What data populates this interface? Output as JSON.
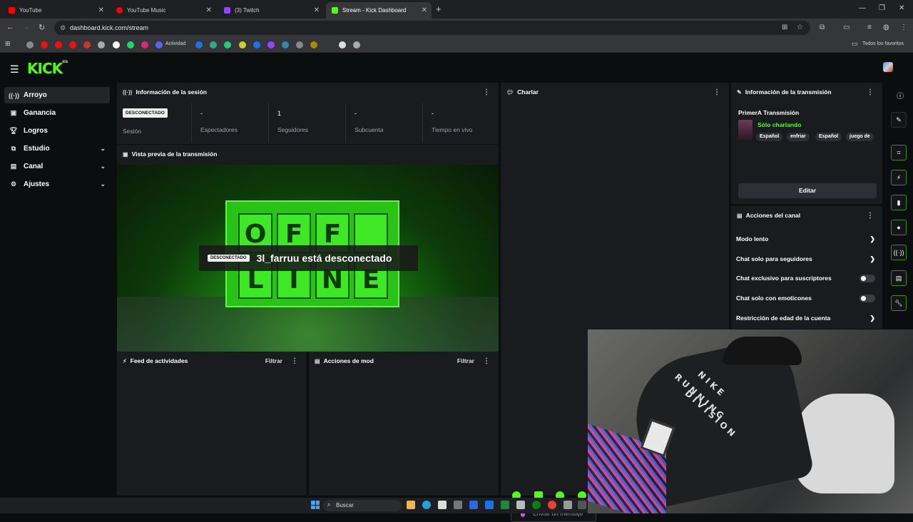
{
  "browser": {
    "tabs": [
      {
        "label": "YouTube",
        "favicon_color": "#ff0000"
      },
      {
        "label": "YouTube Music",
        "favicon_color": "#ff0000"
      },
      {
        "label": "(3) Twitch",
        "favicon_color": "#9146ff"
      },
      {
        "label": "Stream - Kick Dashboard",
        "favicon_color": "#53fc18",
        "active": true
      }
    ],
    "url": "dashboard.kick.com/stream",
    "bookmarks": {
      "actividad_label": "Actividad",
      "all_favorites_label": "Todos los favoritos"
    }
  },
  "app": {
    "logo": "KICK",
    "logo_badge": "BETA",
    "accent_color": "#53fc18"
  },
  "sidebar": {
    "items": [
      {
        "label": "Arroyo",
        "icon": "broadcast-icon",
        "active": true
      },
      {
        "label": "Ganancia",
        "icon": "money-icon"
      },
      {
        "label": "Logros",
        "icon": "trophy-icon"
      },
      {
        "label": "Estudio",
        "icon": "studio-icon",
        "expandable": true
      },
      {
        "label": "Canal",
        "icon": "channel-icon",
        "expandable": true
      },
      {
        "label": "Ajustes",
        "icon": "gear-icon",
        "expandable": true
      }
    ]
  },
  "session": {
    "title": "Información de la sesión",
    "status_badge": "DESCONECTADO",
    "status_label": "Sesión",
    "stats": [
      {
        "value": "-",
        "label": "Espectadores"
      },
      {
        "value": "1",
        "label": "Seguidores"
      },
      {
        "value": "-",
        "label": "Subcuenta"
      },
      {
        "value": "-",
        "label": "Tiempo en vivo"
      }
    ]
  },
  "preview": {
    "title": "Vista previa de la transmisión",
    "sign_letters": [
      "O",
      "F",
      "F",
      "",
      "L",
      "I",
      "N",
      "E"
    ],
    "overlay_badge": "DESCONECTADO",
    "overlay_message": "3l_farruu está desconectado"
  },
  "activity_feed": {
    "title": "Feed de actividades",
    "filter_label": "Filtrar"
  },
  "mod_actions": {
    "title": "Acciones de mod",
    "filter_label": "Filtrar"
  },
  "chat": {
    "title": "Charlar",
    "input_placeholder": "Enviar un mensaje"
  },
  "stream_info": {
    "title": "Información de la transmisión",
    "stream_title": "PrimerA Transmisión",
    "category": "Sólo charlando",
    "tags": [
      "Español",
      "enfriar",
      "Español",
      "juego de"
    ],
    "edit_label": "Editar"
  },
  "channel_actions": {
    "title": "Acciones del canal",
    "rows": [
      {
        "label": "Modo lento",
        "control": "chevron"
      },
      {
        "label": "Chat solo para seguidores",
        "control": "chevron"
      },
      {
        "label": "Chat exclusivo para suscriptores",
        "control": "toggle",
        "on": false
      },
      {
        "label": "Chat solo con emoticones",
        "control": "toggle",
        "on": false
      },
      {
        "label": "Restricción de edad de la cuenta",
        "control": "chevron"
      }
    ]
  },
  "webcam": {
    "shirt_line1": "NIKE",
    "shirt_line2": "RUNNING",
    "shirt_line3": "DIVISION"
  },
  "taskbar": {
    "search_label": "Buscar"
  }
}
